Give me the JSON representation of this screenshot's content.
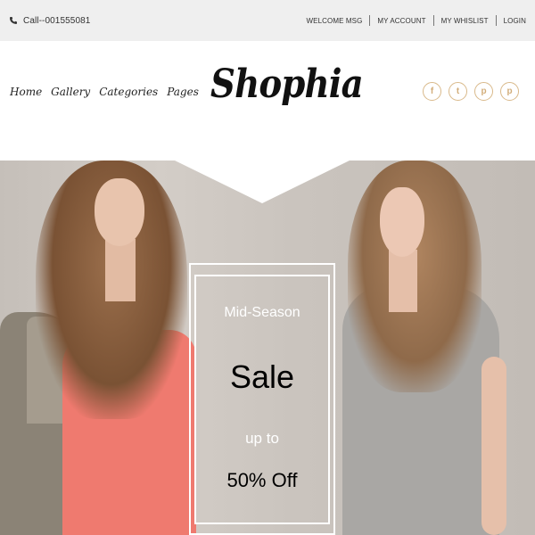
{
  "topbar": {
    "call": "Call--001555081",
    "links": [
      "WELCOME MSG",
      "MY ACCOUNT",
      "MY WHISLIST",
      "LOGIN"
    ]
  },
  "nav": {
    "items": [
      "Home",
      "Gallery",
      "Categories",
      "Pages"
    ]
  },
  "logo": "Shophia",
  "socials": [
    {
      "icon": "facebook-icon",
      "glyph": "f"
    },
    {
      "icon": "twitter-icon",
      "glyph": "t"
    },
    {
      "icon": "pinterest-icon",
      "glyph": "p"
    },
    {
      "icon": "pinterest-circle-icon",
      "glyph": "p"
    }
  ],
  "hero": {
    "line1": "Mid-Season",
    "line2": "Sale",
    "line3": "up to",
    "line4": "50% Off"
  },
  "colors": {
    "accent": "#d9b98a",
    "topbar_bg": "#efefef"
  }
}
